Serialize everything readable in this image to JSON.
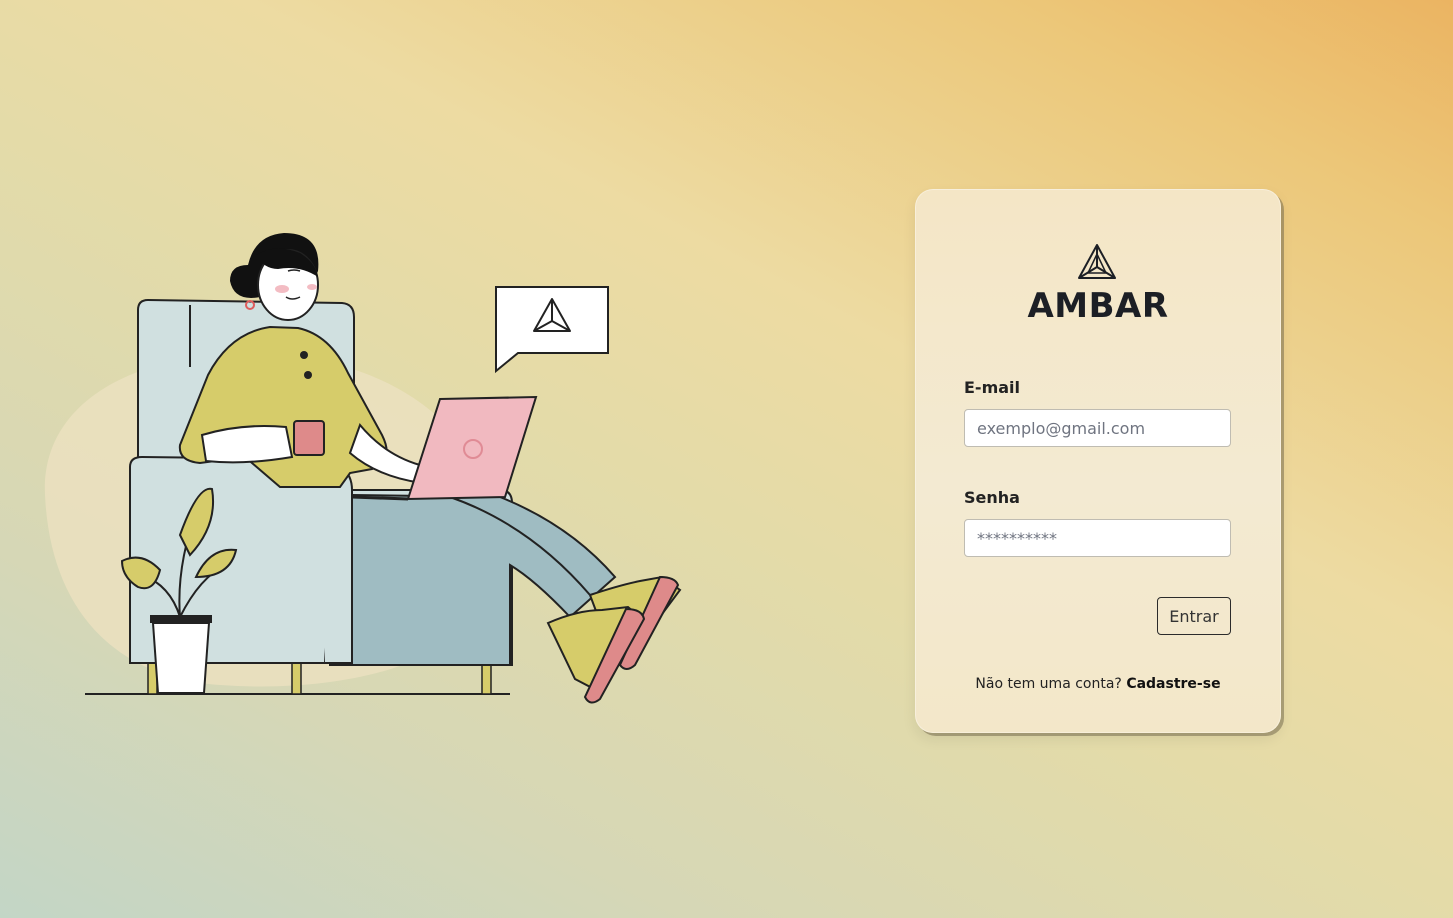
{
  "brand": {
    "name": "AMBAR",
    "logo_icon": "triangle-logo-icon"
  },
  "illustration": {
    "icon": "woman-on-armchair-with-laptop-illustration"
  },
  "form": {
    "email": {
      "label": "E-mail",
      "placeholder": "exemplo@gmail.com",
      "value": ""
    },
    "password": {
      "label": "Senha",
      "placeholder": "**********",
      "value": ""
    },
    "submit_label": "Entrar"
  },
  "signup": {
    "prompt": "Não tem uma conta?",
    "link_label": "Cadastre-se"
  },
  "colors": {
    "background_start": "#c3d6c6",
    "background_end": "#ebb462",
    "card": "#f4e8cc",
    "text_dark": "#1c1f25",
    "chair": "#d0e0e0",
    "shirt": "#d6cc6a",
    "laptop": "#f1b9c0",
    "pants": "#9fbcc2"
  }
}
